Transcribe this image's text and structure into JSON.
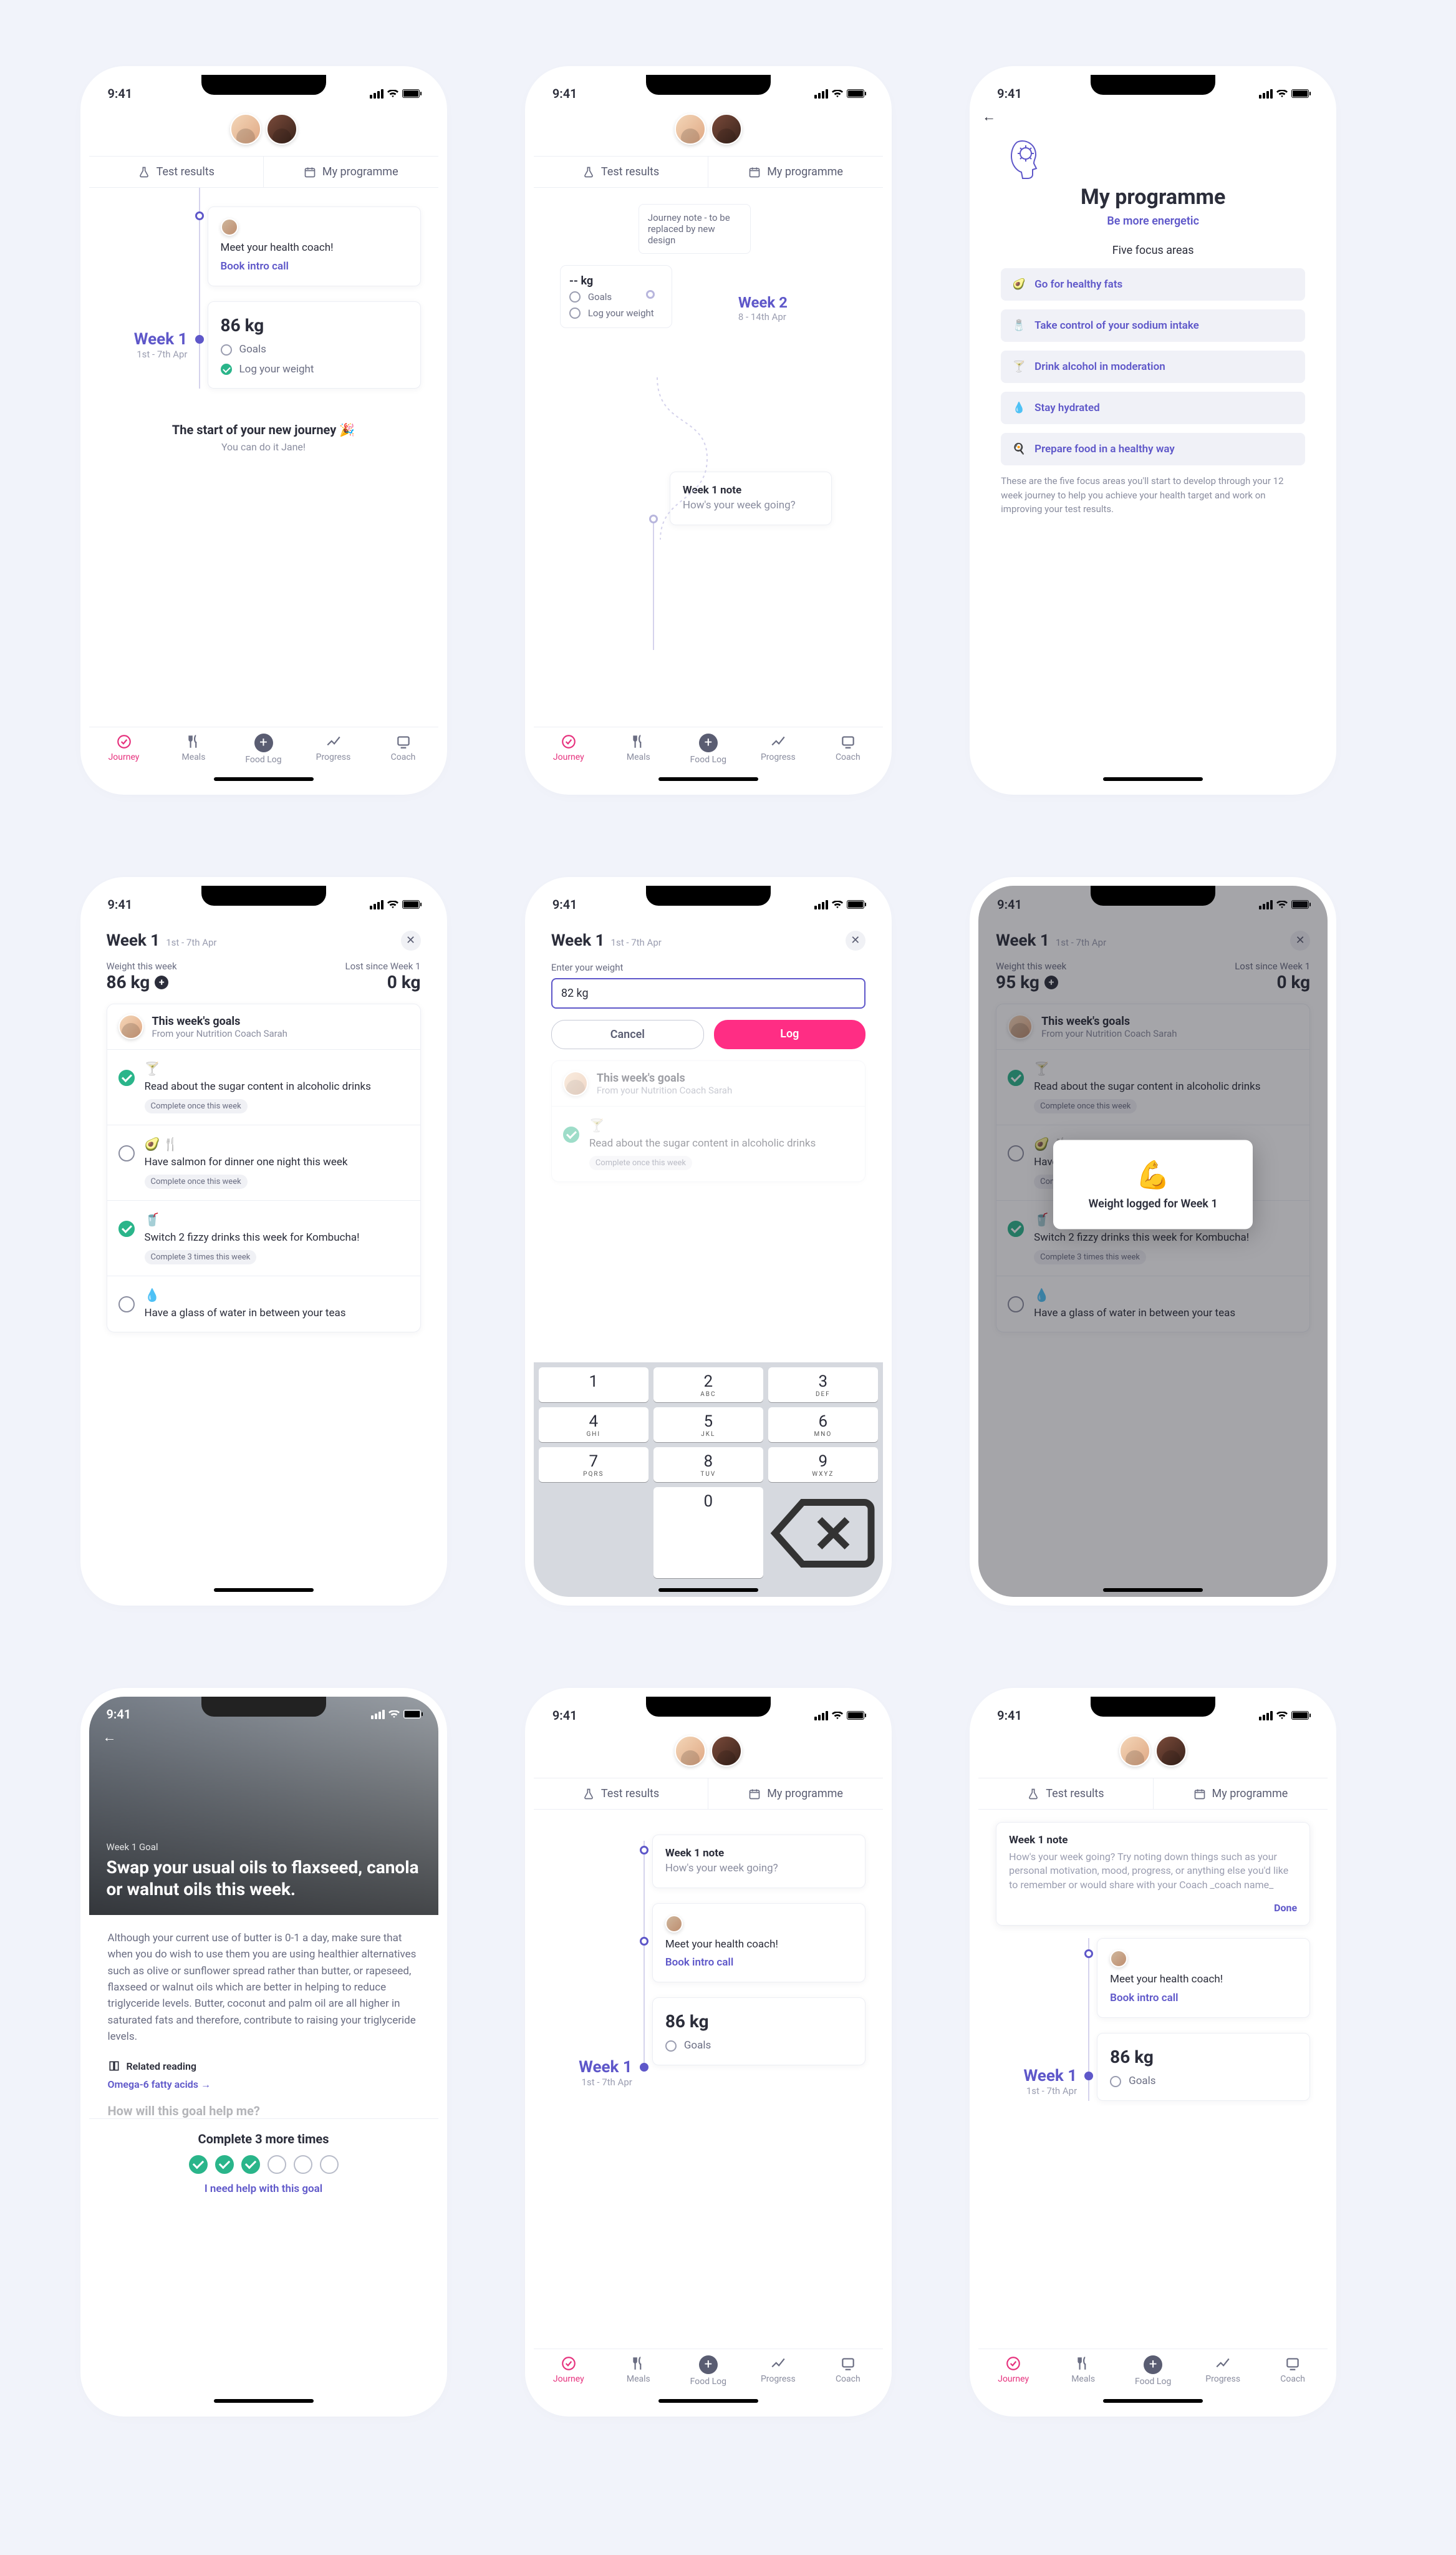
{
  "status_time": "9:41",
  "tabs": {
    "test_results": "Test results",
    "my_programme": "My programme"
  },
  "nav": {
    "journey": "Journey",
    "meals": "Meals",
    "foodlog": "Food Log",
    "progress": "Progress",
    "coach": "Coach"
  },
  "s1": {
    "coach_card": {
      "text": "Meet your health coach!",
      "cta": "Book intro call"
    },
    "weight_card": {
      "value": "86 kg",
      "goals": "Goals",
      "log": "Log your weight"
    },
    "week": {
      "title": "Week 1",
      "date": "1st - 7th Apr"
    },
    "foot": {
      "line1": "The start of your new journey 🎉",
      "line2": "You can do it Jane!"
    }
  },
  "s2": {
    "note": "Journey note - to be replaced by new design",
    "kg_card": {
      "value": "-- kg",
      "goals": "Goals",
      "log": "Log your weight"
    },
    "week2": {
      "title": "Week 2",
      "date": "8 - 14th Apr"
    },
    "wk1_note": {
      "title": "Week 1 note",
      "body": "How's your week going?"
    }
  },
  "s3": {
    "title": "My programme",
    "subtitle": "Be more energetic",
    "areas_label": "Five focus areas",
    "areas": [
      "Go for healthy fats",
      "Take control of your sodium intake",
      "Drink alcohol in moderation",
      "Stay hydrated",
      "Prepare food in a healthy way"
    ],
    "desc": "These are the five focus areas you'll start to develop through your 12 week journey to help you achieve your health target and work on improving your test results."
  },
  "sheet_week": {
    "title": "Week 1",
    "date": "1st - 7th Apr"
  },
  "s4": {
    "wtw": "Weight this week",
    "wtw_v": "86 kg",
    "lost": "Lost since Week 1",
    "lost_v": "0 kg",
    "goals_title": "This week's goals",
    "goals_sub": "From your Nutrition Coach Sarah",
    "items": [
      {
        "done": true,
        "text": "Read about the sugar content in alcoholic drinks",
        "pill": "Complete once this week"
      },
      {
        "done": false,
        "text": "Have salmon for dinner one night this week",
        "pill": "Complete once this week"
      },
      {
        "done": true,
        "text": "Switch 2 fizzy drinks this week for Kombucha!",
        "pill": "Complete 3 times this week"
      },
      {
        "done": false,
        "text": "Have a glass of water in between your teas",
        "pill": ""
      }
    ]
  },
  "s5": {
    "label": "Enter your weight",
    "value": "82 kg",
    "cancel": "Cancel",
    "log": "Log",
    "goals_title": "This week's goals",
    "goals_sub": "From your Nutrition Coach Sarah",
    "item_text": "Read about the sugar content in alcoholic drinks",
    "item_pill": "Complete once this week",
    "keys": [
      [
        "1",
        ""
      ],
      [
        "2",
        "ABC"
      ],
      [
        "3",
        "DEF"
      ],
      [
        "4",
        "GHI"
      ],
      [
        "5",
        "JKL"
      ],
      [
        "6",
        "MNO"
      ],
      [
        "7",
        "PQRS"
      ],
      [
        "8",
        "TUV"
      ],
      [
        "9",
        "WXYZ"
      ],
      [
        "",
        ""
      ],
      [
        "0",
        ""
      ],
      [
        "⌫",
        ""
      ]
    ]
  },
  "s6": {
    "wtw": "Weight this week",
    "wtw_v": "95 kg",
    "lost": "Lost since Week 1",
    "lost_v": "0 kg",
    "toast": "Weight logged for Week 1"
  },
  "s7": {
    "label": "Week 1 Goal",
    "title": "Swap your usual oils to flaxseed, canola or walnut oils this week.",
    "body": "Although your current use of butter is 0-1 a day, make sure that when you do wish to use them you are using healthier alternatives such as olive or sunflower spread rather than butter, or rapeseed, flaxseed or walnut oils which are better in helping to reduce triglyceride levels. Butter, coconut and palm oil are all higher in saturated fats and therefore, contribute to raising your triglyceride levels.",
    "related_label": "Related reading",
    "related_link": "Omega-6 fatty acids  →",
    "help_q": "How will this goal help me?",
    "complete_title": "Complete 3 more times",
    "help_link": "I need help with this goal"
  },
  "s8": {
    "note": {
      "title": "Week 1 note",
      "body": "How's your week going?"
    },
    "coach_card": {
      "text": "Meet your health coach!",
      "cta": "Book intro call"
    },
    "weight": "86 kg",
    "goals": "Goals",
    "week": {
      "title": "Week 1",
      "date": "1st - 7th Apr"
    }
  },
  "s9": {
    "note_title": "Week 1 note",
    "note_placeholder": "How's your week going? Try noting down things such as your personal motivation, mood, progress, or anything else you'd like to remember or would share with your Coach _coach name_",
    "done": "Done",
    "coach_card": {
      "text": "Meet your health coach!",
      "cta": "Book intro call"
    },
    "weight": "86 kg",
    "goals": "Goals",
    "week": {
      "title": "Week 1",
      "date": "1st - 7th Apr"
    }
  }
}
